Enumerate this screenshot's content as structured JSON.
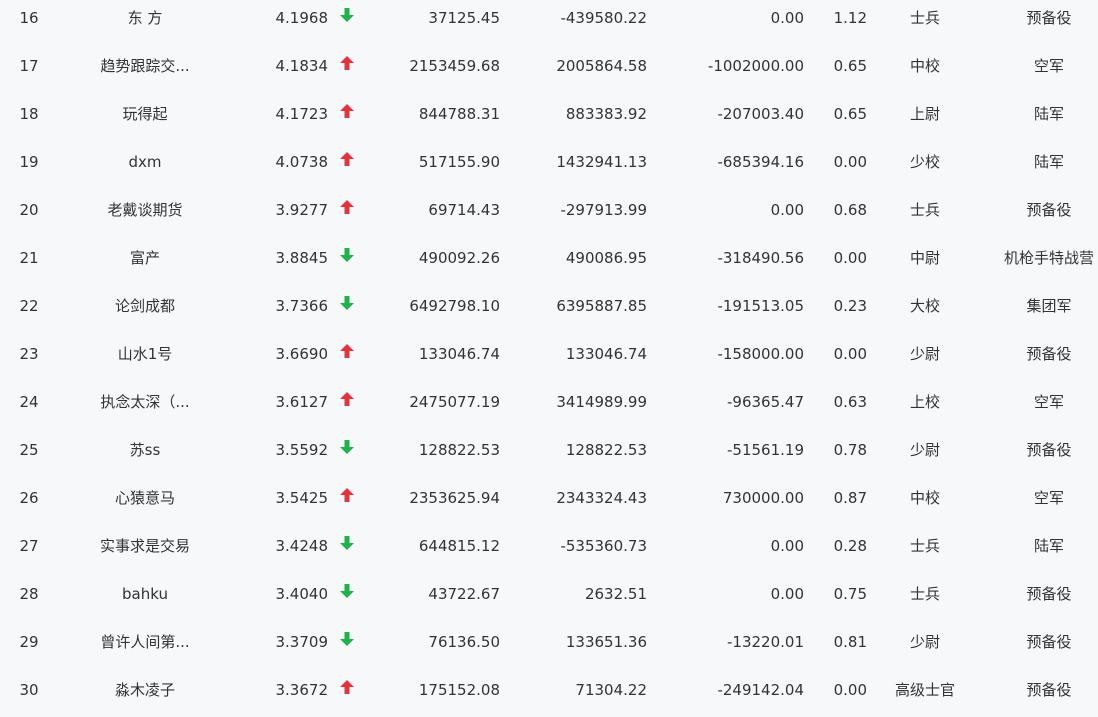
{
  "colors": {
    "up": "#e5333a",
    "down": "#22b04b",
    "text": "#333333",
    "background": "#f7f8fa"
  },
  "icons": {
    "up": "arrow-up-icon",
    "down": "arrow-down-icon"
  },
  "rows": [
    {
      "rank": "16",
      "name": "东 方",
      "score": "4.1968",
      "trend": "down",
      "v1": "37125.45",
      "v2": "-439580.22",
      "v3": "0.00",
      "ratio": "1.12",
      "military_rank": "士兵",
      "unit": "预备役"
    },
    {
      "rank": "17",
      "name": "趋势跟踪交...",
      "score": "4.1834",
      "trend": "up",
      "v1": "2153459.68",
      "v2": "2005864.58",
      "v3": "-1002000.00",
      "ratio": "0.65",
      "military_rank": "中校",
      "unit": "空军"
    },
    {
      "rank": "18",
      "name": "玩得起",
      "score": "4.1723",
      "trend": "up",
      "v1": "844788.31",
      "v2": "883383.92",
      "v3": "-207003.40",
      "ratio": "0.65",
      "military_rank": "上尉",
      "unit": "陆军"
    },
    {
      "rank": "19",
      "name": "dxm",
      "score": "4.0738",
      "trend": "up",
      "v1": "517155.90",
      "v2": "1432941.13",
      "v3": "-685394.16",
      "ratio": "0.00",
      "military_rank": "少校",
      "unit": "陆军"
    },
    {
      "rank": "20",
      "name": "老戴谈期货",
      "score": "3.9277",
      "trend": "up",
      "v1": "69714.43",
      "v2": "-297913.99",
      "v3": "0.00",
      "ratio": "0.68",
      "military_rank": "士兵",
      "unit": "预备役"
    },
    {
      "rank": "21",
      "name": "富产",
      "score": "3.8845",
      "trend": "down",
      "v1": "490092.26",
      "v2": "490086.95",
      "v3": "-318490.56",
      "ratio": "0.00",
      "military_rank": "中尉",
      "unit": "机枪手特战营"
    },
    {
      "rank": "22",
      "name": "论剑成都",
      "score": "3.7366",
      "trend": "down",
      "v1": "6492798.10",
      "v2": "6395887.85",
      "v3": "-191513.05",
      "ratio": "0.23",
      "military_rank": "大校",
      "unit": "集团军"
    },
    {
      "rank": "23",
      "name": "山水1号",
      "score": "3.6690",
      "trend": "up",
      "v1": "133046.74",
      "v2": "133046.74",
      "v3": "-158000.00",
      "ratio": "0.00",
      "military_rank": "少尉",
      "unit": "预备役"
    },
    {
      "rank": "24",
      "name": "执念太深（...",
      "score": "3.6127",
      "trend": "up",
      "v1": "2475077.19",
      "v2": "3414989.99",
      "v3": "-96365.47",
      "ratio": "0.63",
      "military_rank": "上校",
      "unit": "空军"
    },
    {
      "rank": "25",
      "name": "苏ss",
      "score": "3.5592",
      "trend": "down",
      "v1": "128822.53",
      "v2": "128822.53",
      "v3": "-51561.19",
      "ratio": "0.78",
      "military_rank": "少尉",
      "unit": "预备役"
    },
    {
      "rank": "26",
      "name": "心猿意马",
      "score": "3.5425",
      "trend": "up",
      "v1": "2353625.94",
      "v2": "2343324.43",
      "v3": "730000.00",
      "ratio": "0.87",
      "military_rank": "中校",
      "unit": "空军"
    },
    {
      "rank": "27",
      "name": "实事求是交易",
      "score": "3.4248",
      "trend": "down",
      "v1": "644815.12",
      "v2": "-535360.73",
      "v3": "0.00",
      "ratio": "0.28",
      "military_rank": "士兵",
      "unit": "陆军"
    },
    {
      "rank": "28",
      "name": "bahku",
      "score": "3.4040",
      "trend": "down",
      "v1": "43722.67",
      "v2": "2632.51",
      "v3": "0.00",
      "ratio": "0.75",
      "military_rank": "士兵",
      "unit": "预备役"
    },
    {
      "rank": "29",
      "name": "曾许人间第...",
      "score": "3.3709",
      "trend": "down",
      "v1": "76136.50",
      "v2": "133651.36",
      "v3": "-13220.01",
      "ratio": "0.81",
      "military_rank": "少尉",
      "unit": "预备役"
    },
    {
      "rank": "30",
      "name": "淼木凌子",
      "score": "3.3672",
      "trend": "up",
      "v1": "175152.08",
      "v2": "71304.22",
      "v3": "-249142.04",
      "ratio": "0.00",
      "military_rank": "高级士官",
      "unit": "预备役"
    }
  ]
}
